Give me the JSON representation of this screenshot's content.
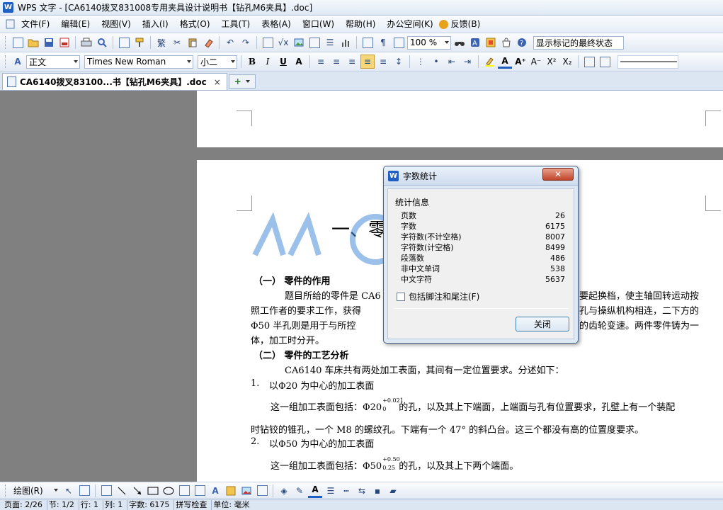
{
  "window": {
    "title": "WPS 文字 - [CA6140拨叉831008专用夹具设计说明书【钻孔M6夹具】.doc]",
    "app_logo": "W"
  },
  "menu": {
    "items": [
      "文件(F)",
      "编辑(E)",
      "视图(V)",
      "插入(I)",
      "格式(O)",
      "工具(T)",
      "表格(A)",
      "窗口(W)",
      "帮助(H)",
      "办公空间(K)",
      "反馈(B)"
    ]
  },
  "toolbar1": {
    "zoom": "100 %",
    "markup_mode": "显示标记的最终状态"
  },
  "toolbar2": {
    "style": "正文",
    "font": "Times New Roman",
    "size": "小二"
  },
  "tabs": {
    "doc_tab": "CA6140拨叉83100...书【钻孔M6夹具】.doc",
    "close_glyph": "×",
    "add_glyph": "+"
  },
  "document": {
    "heading_partial": "一、零",
    "s1_title": "（一） 零件的作用",
    "p1_l1a": "题目所给的零件是 CA6",
    "p1_l1b": "要起换档，使主轴回转运动按",
    "p1_l2a": "照工作者的要求工作，获得",
    "p1_l2b": "孔与操纵机构相连，二下方的",
    "p1_l3a": "Φ50 半孔则是用于与所控",
    "p1_l3b": "的齿轮变速。两件零件铸为一",
    "p1_l4": "体，加工时分开。",
    "s2_title": "（二） 零件的工艺分析",
    "p2": "CA6140 车床共有两处加工表面，其间有一定位置要求。分述如下：",
    "item1_num": "1.",
    "item1": "以Φ20 为中心的加工表面",
    "p3a": "这一组加工表面包括：Φ20",
    "p3_sup": "+0.021",
    "p3_sub": "0",
    "p3b": "的孔，以及其上下端面，上端面与孔有位置要求，孔壁上有一个装配",
    "p4": "时钻铰的锥孔，一个 M8 的螺纹孔。下端有一个 47° 的斜凸台。这三个都没有高的位置度要求。",
    "item2_num": "2.",
    "item2": "以Φ50 为中心的加工表面",
    "p5a": "这一组加工表面包括：Φ50",
    "p5_sup": "+0.50",
    "p5_sub": "0.25",
    "p5b": "的孔，以及其上下两个端面。"
  },
  "dialog": {
    "logo": "W",
    "title": "字数统计",
    "close_glyph": "✕",
    "group_label": "统计信息",
    "stats": [
      {
        "label": "页数",
        "value": "26"
      },
      {
        "label": "字数",
        "value": "6175"
      },
      {
        "label": "字符数(不计空格)",
        "value": "8007"
      },
      {
        "label": "字符数(计空格)",
        "value": "8499"
      },
      {
        "label": "段落数",
        "value": "486"
      },
      {
        "label": "非中文单词",
        "value": "538"
      },
      {
        "label": "中文字符",
        "value": "5637"
      }
    ],
    "checkbox_label": "包括脚注和尾注(F)",
    "close_button": "关闭"
  },
  "drawbar": {
    "draw_label": "绘图(R)"
  },
  "status": {
    "page": "页面: 2/26",
    "section": "节: 1/2",
    "row": "行: 1",
    "col": "列: 1",
    "words": "字数: 6175",
    "spell": "拼写检查",
    "unit": "单位: 毫米"
  },
  "colors": {
    "accent": "#1f5fc4",
    "dialog_close": "#c0452b",
    "watermark": "#4a90d9"
  }
}
